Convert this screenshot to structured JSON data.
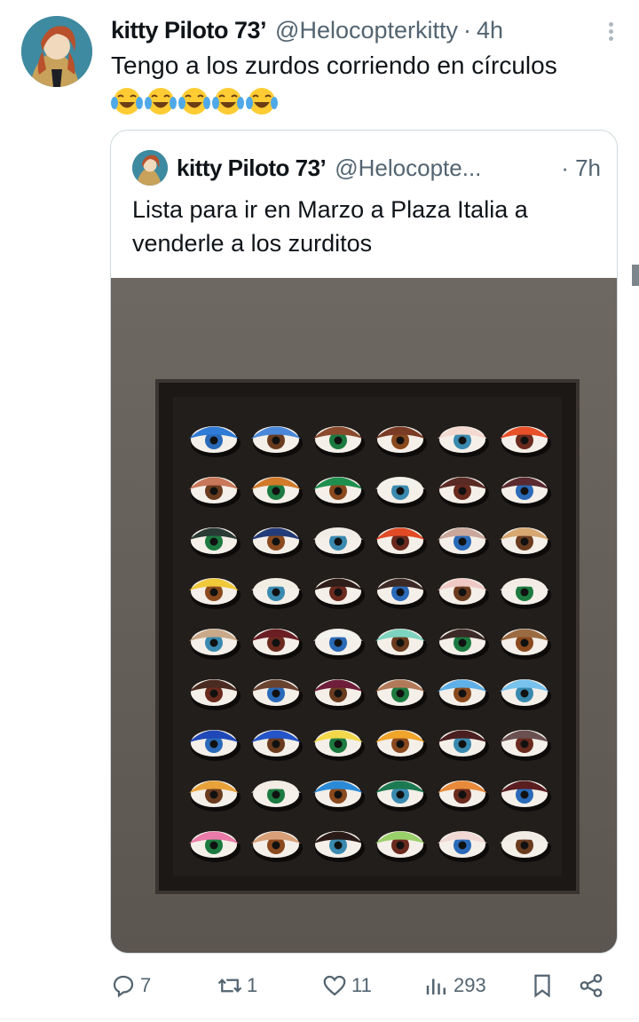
{
  "tweet": {
    "author_name": "kitty Piloto 73’",
    "handle": "@Helocopterkitty",
    "separator": "·",
    "time": "4h",
    "text": "Tengo a los zurdos corriendo en círculos",
    "emoji_count": 5
  },
  "quoted": {
    "author_name": "kitty Piloto 73’",
    "handle": "@Helocopte...",
    "time": "· 7h",
    "text": "Lista para ir en Marzo a Plaza Italia a venderle a los zurditos"
  },
  "actions": {
    "replies": "7",
    "retweets": "1",
    "likes": "11",
    "views": "293"
  },
  "icons": {
    "more": "more-vertical-icon",
    "reply": "reply-icon",
    "retweet": "retweet-icon",
    "like": "heart-icon",
    "views": "views-icon",
    "bookmark": "bookmark-icon",
    "share": "share-icon"
  },
  "colors": {
    "text_primary": "#0f1419",
    "text_secondary": "#536471",
    "border": "#cfd9de"
  }
}
